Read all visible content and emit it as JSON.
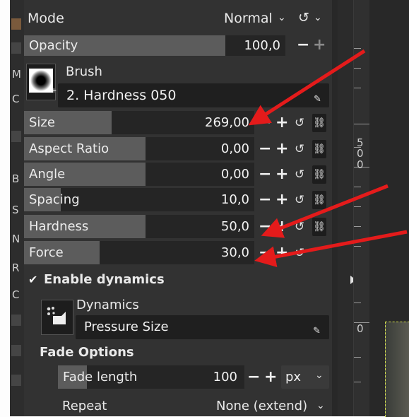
{
  "left_strip_chars": [
    "M",
    "C",
    "B",
    "S",
    "N",
    "R",
    "C"
  ],
  "mode": {
    "label": "Mode",
    "value": "Normal"
  },
  "opacity": {
    "label": "Opacity",
    "value": "100,0",
    "fraction": 0.77
  },
  "brush": {
    "label": "Brush",
    "name": "2. Hardness 050"
  },
  "sliders": [
    {
      "label": "Size",
      "value": "269,00",
      "fraction": 0.36
    },
    {
      "label": "Aspect Ratio",
      "value": "0,00",
      "fraction": 0.5
    },
    {
      "label": "Angle",
      "value": "0,00",
      "fraction": 0.5
    },
    {
      "label": "Spacing",
      "value": "10,0",
      "fraction": 0.15
    },
    {
      "label": "Hardness",
      "value": "50,0",
      "fraction": 0.5
    },
    {
      "label": "Force",
      "value": "30,0",
      "fraction": 0.31
    }
  ],
  "dynamics": {
    "enable_label": "Enable dynamics",
    "label": "Dynamics",
    "name": "Pressure Size"
  },
  "fade": {
    "title": "Fade Options",
    "length_label": "Fade length",
    "length_value": "100",
    "unit": "px",
    "repeat_label": "Repeat",
    "repeat_value": "None (extend)"
  },
  "ruler_numbers": [
    "5",
    "0",
    "0",
    "0"
  ],
  "colors": {
    "panel": "#323232",
    "slider_fill": "#5c5c5c",
    "arrow": "#e41b1b"
  }
}
